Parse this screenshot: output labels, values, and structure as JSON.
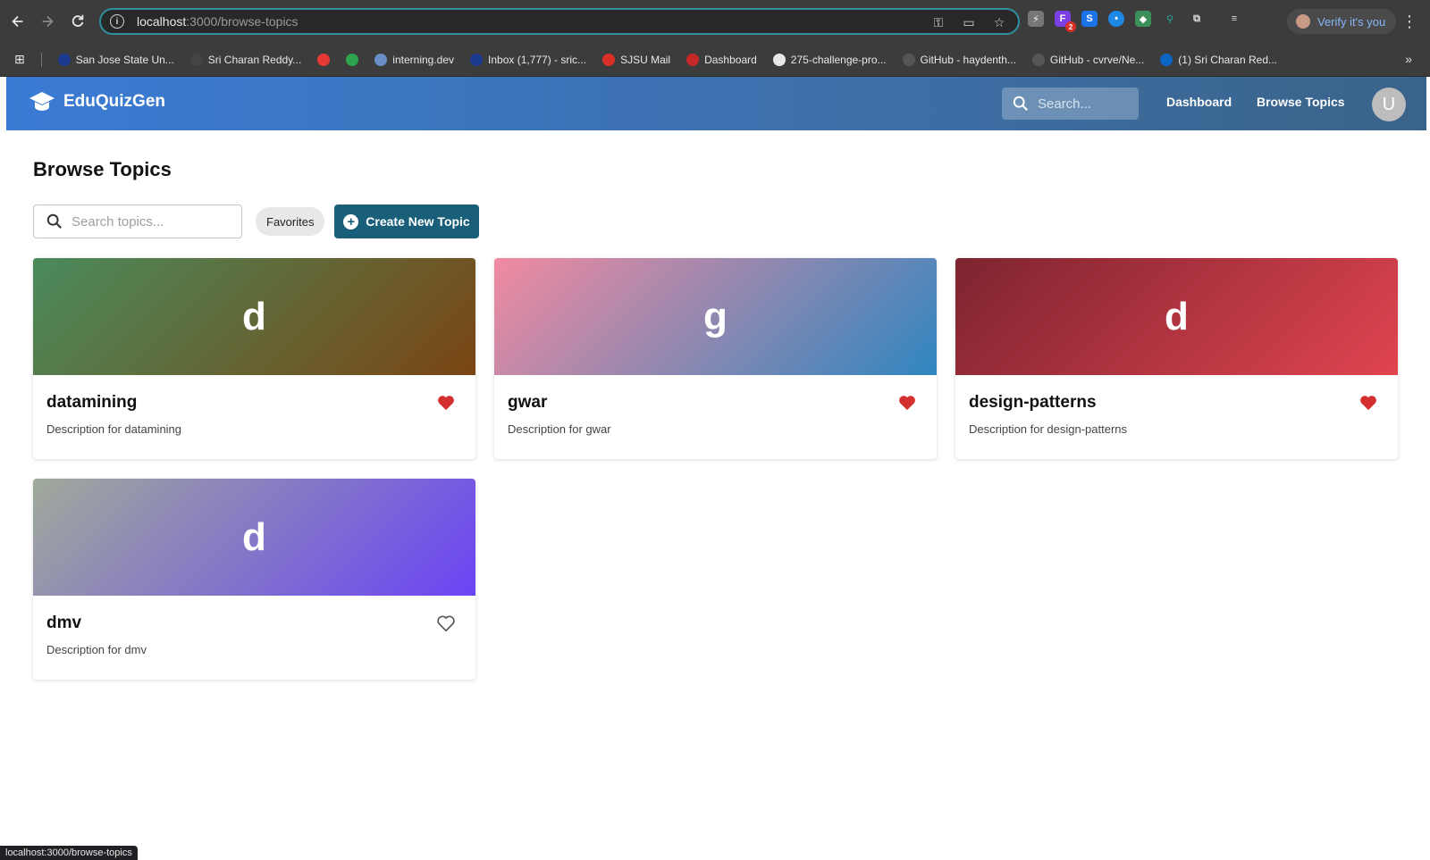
{
  "browser": {
    "url_host": "localhost",
    "url_path": ":3000/browse-topics",
    "verify_label": "Verify it's you",
    "ext_badge": "2",
    "status_url": "localhost:3000/browse-topics"
  },
  "bookmarks": [
    {
      "label": "San Jose State Un...",
      "color": "#1a3a8f"
    },
    {
      "label": "Sri Charan Reddy...",
      "color": "#444444"
    },
    {
      "label": "",
      "color": "#e53935"
    },
    {
      "label": "",
      "color": "#2ea44f"
    },
    {
      "label": "interning.dev",
      "color": "#6a8fc7"
    },
    {
      "label": "Inbox (1,777) - sric...",
      "color": "#1a3a8f"
    },
    {
      "label": "SJSU Mail",
      "color": "#d93025"
    },
    {
      "label": "Dashboard",
      "color": "#c62828"
    },
    {
      "label": "275-challenge-pro...",
      "color": "#e8e8e8"
    },
    {
      "label": "GitHub - haydenth...",
      "color": "#555555"
    },
    {
      "label": "GitHub - cvrve/Ne...",
      "color": "#555555"
    },
    {
      "label": "(1) Sri Charan Red...",
      "color": "#0a66c2"
    }
  ],
  "header": {
    "brand": "EduQuizGen",
    "search_placeholder": "Search...",
    "nav_dashboard": "Dashboard",
    "nav_browse": "Browse Topics",
    "avatar_letter": "U"
  },
  "page": {
    "title": "Browse Topics",
    "search_placeholder": "Search topics...",
    "favorites_label": "Favorites",
    "create_label": "Create New Topic"
  },
  "topics": [
    {
      "letter": "d",
      "name": "datamining",
      "description": "Description for datamining",
      "favorite": true,
      "gradient": [
        "#4a8b5c",
        "#7a4513"
      ]
    },
    {
      "letter": "g",
      "name": "gwar",
      "description": "Description for gwar",
      "favorite": true,
      "gradient": [
        "#f28aa0",
        "#2f86c0"
      ]
    },
    {
      "letter": "d",
      "name": "design-patterns",
      "description": "Description for design-patterns",
      "favorite": true,
      "gradient": [
        "#7d2430",
        "#e0444f"
      ]
    },
    {
      "letter": "d",
      "name": "dmv",
      "description": "Description for dmv",
      "favorite": false,
      "gradient": [
        "#a0aa9a",
        "#6a44f5"
      ]
    }
  ],
  "colors": {
    "accent": "#1a5f7a",
    "heart": "#d32f2f"
  }
}
